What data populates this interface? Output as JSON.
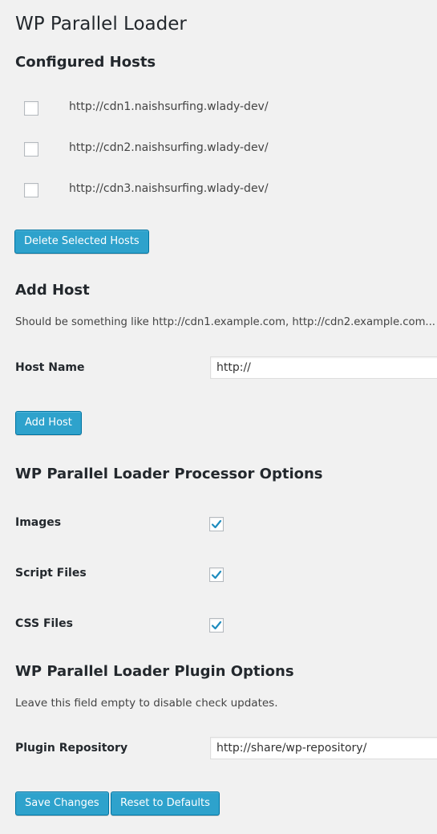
{
  "page": {
    "title": "WP Parallel Loader"
  },
  "configured_hosts": {
    "heading": "Configured Hosts",
    "hosts": [
      {
        "url": "http://cdn1.naishsurfing.wlady-dev/",
        "checked": false
      },
      {
        "url": "http://cdn2.naishsurfing.wlady-dev/",
        "checked": false
      },
      {
        "url": "http://cdn3.naishsurfing.wlady-dev/",
        "checked": false
      }
    ],
    "delete_button": "Delete Selected Hosts"
  },
  "add_host": {
    "heading": "Add Host",
    "description": "Should be something like http://cdn1.example.com, http://cdn2.example.com...",
    "host_name_label": "Host Name",
    "host_name_value": "http://",
    "add_button": "Add Host"
  },
  "processor_options": {
    "heading": "WP Parallel Loader Processor Options",
    "options": [
      {
        "label": "Images",
        "checked": true
      },
      {
        "label": "Script Files",
        "checked": true
      },
      {
        "label": "CSS Files",
        "checked": true
      }
    ]
  },
  "plugin_options": {
    "heading": "WP Parallel Loader Plugin Options",
    "description": "Leave this field empty to disable check updates.",
    "repository_label": "Plugin Repository",
    "repository_value": "http://share/wp-repository/"
  },
  "footer": {
    "save_button": "Save Changes",
    "reset_button": "Reset to Defaults"
  },
  "colors": {
    "background": "#f1f1f1",
    "button": "#2ea2cc",
    "button_border": "#0074a2",
    "checkmark": "#1e8cbe"
  },
  "icons": {
    "checkmark": "check-icon"
  }
}
